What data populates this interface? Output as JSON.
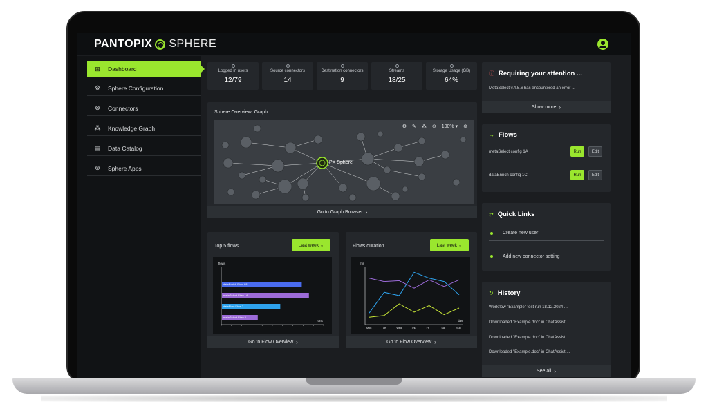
{
  "header": {
    "logo_bold": "PANTOPIX",
    "logo_thin": "SPHERE",
    "accent": "#9ae62e"
  },
  "sidebar": {
    "items": [
      {
        "label": "Dashboard",
        "icon": "grid-icon",
        "glyph": "⊞",
        "active": true
      },
      {
        "label": "Sphere Configuration",
        "icon": "gear-icon",
        "glyph": "⚙"
      },
      {
        "label": "Connectors",
        "icon": "plug-icon",
        "glyph": "⊗"
      },
      {
        "label": "Knowledge Graph",
        "icon": "network-icon",
        "glyph": "⁂"
      },
      {
        "label": "Data Catalog",
        "icon": "document-icon",
        "glyph": "▤"
      },
      {
        "label": "Sphere Apps",
        "icon": "apps-icon",
        "glyph": "⊛"
      }
    ]
  },
  "stats": [
    {
      "label": "Logged in users",
      "value": "12/79"
    },
    {
      "label": "Source connectors",
      "value": "14"
    },
    {
      "label": "Destination connectors",
      "value": "9"
    },
    {
      "label": "Streams",
      "value": "18/25"
    },
    {
      "label": "Storage Usage (GB)",
      "value": "64%"
    }
  ],
  "graph": {
    "title": "Sphere Overview: Graph",
    "zoom": "100%",
    "center_label": "PX Sphere",
    "link": "Go to Graph Browser"
  },
  "top_flows": {
    "title": "Top 5 flows",
    "period": "Last week",
    "link": "Go to Flow Overview",
    "chart_data": {
      "type": "bar",
      "orientation": "horizontal",
      "ylabel": "flows",
      "xlabel": "runs",
      "categories": [
        "dataEnrich Flow A8",
        "metaSelect Flow 1A",
        "dataFlow Flow 2",
        "metaSelect Flow 3"
      ],
      "values": [
        78,
        85,
        57,
        35
      ],
      "colors": [
        "#4a6cf0",
        "#9c6bd8",
        "#2ea3ee",
        "#9c6bd8"
      ],
      "xlim": [
        0,
        100
      ]
    }
  },
  "flows_duration": {
    "title": "Flows duration",
    "period": "Last week",
    "link": "Go to Flow Overview",
    "chart_data": {
      "type": "line",
      "ylabel": "min",
      "xlabel": "dav",
      "categories": [
        "Mon",
        "Tue",
        "Wed",
        "Thu",
        "Fri",
        "Sat",
        "Sun"
      ],
      "ylim": [
        0,
        140
      ],
      "series": [
        {
          "color": "#9c6bd8",
          "values": [
            112,
            104,
            106,
            88,
            108,
            92,
            108
          ]
        },
        {
          "color": "#2ea3ee",
          "values": [
            28,
            78,
            70,
            126,
            112,
            104,
            72
          ]
        },
        {
          "color": "#c8e636",
          "values": [
            18,
            22,
            50,
            30,
            46,
            24,
            40
          ]
        }
      ]
    }
  },
  "attention": {
    "title": "Requiring your attention ...",
    "message": "MetaSelect v.4.5.6 has encountered an error ...",
    "link": "Show more"
  },
  "flows": {
    "title": "Flows",
    "rows": [
      {
        "name": "metaSelect config 1A",
        "run": "Run",
        "edit": "Edit"
      },
      {
        "name": "dataEnrich config 1C",
        "run": "Run",
        "edit": "Edit"
      }
    ]
  },
  "quick_links": {
    "title": "Quick Links",
    "items": [
      "Create new user",
      "Add new connector setting"
    ]
  },
  "history": {
    "title": "History",
    "items": [
      "Workflow \"Example\" test run 18.12.2024 ...",
      "Downloaded \"Example.doc\" in ChatAssist ...",
      "Downloaded \"Example.doc\" in ChatAssist ...",
      "Downloaded \"Example.doc\" in ChatAssist ..."
    ],
    "link": "See all"
  }
}
